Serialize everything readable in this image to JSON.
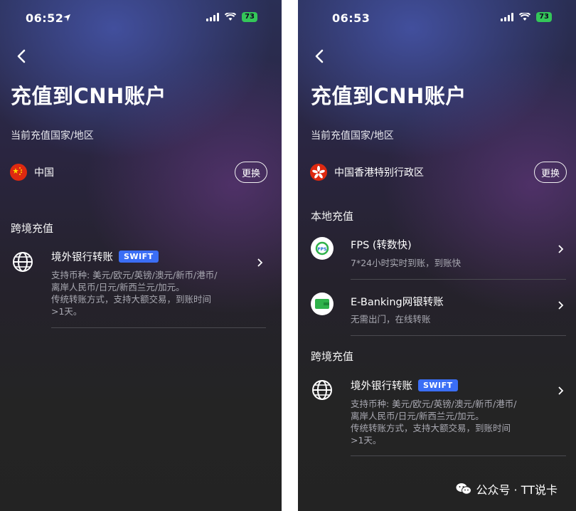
{
  "left": {
    "status_time": "06:52",
    "battery": "73",
    "title": "充值到CNH账户",
    "current_region_label": "当前充值国家/地区",
    "region": "中国",
    "change_label": "更换",
    "cross_border_label": "跨境充值",
    "items": [
      {
        "name": "境外银行转账",
        "badge": "SWIFT",
        "desc1": "支持币种: 美元/欧元/英镑/澳元/新币/港币/",
        "desc2": "离岸人民币/日元/新西兰元/加元。",
        "desc3": "传统转账方式，支持大额交易，到账时间",
        "desc4": ">1天。"
      }
    ]
  },
  "right": {
    "status_time": "06:53",
    "battery": "73",
    "title": "充值到CNH账户",
    "current_region_label": "当前充值国家/地区",
    "region": "中国香港特别行政区",
    "change_label": "更换",
    "local_label": "本地充值",
    "cross_border_label": "跨境充值",
    "local_items": [
      {
        "name": "FPS (转数快)",
        "desc1": "7*24小时实时到账，到账快"
      },
      {
        "name": "E-Banking网银转账",
        "desc1": "无需出门，在线转账"
      }
    ],
    "items": [
      {
        "name": "境外银行转账",
        "badge": "SWIFT",
        "desc1": "支持币种: 美元/欧元/英镑/澳元/新币/港币/",
        "desc2": "离岸人民币/日元/新西兰元/加元。",
        "desc3": "传统转账方式，支持大额交易，到账时间",
        "desc4": ">1天。"
      }
    ]
  },
  "footer": {
    "brand": "公众号 · TT说卡"
  },
  "colors": {
    "accent_badge": "#3b6ef5",
    "battery": "#34c759"
  }
}
